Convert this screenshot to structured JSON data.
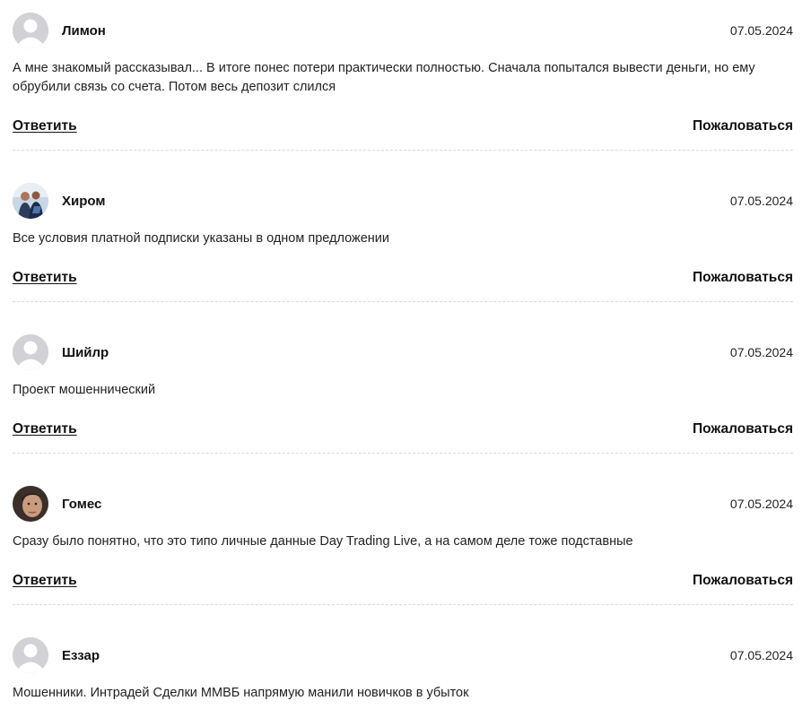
{
  "comments": [
    {
      "author": "Лимон",
      "date": "07.05.2024",
      "text": "А мне знакомый рассказывал... В итоге понес потери практически полностью. Сначала попытался вывести деньги, но ему обрубили связь со счета. Потом весь депозит слился",
      "avatar": "default-avatar-icon",
      "reply_label": "Ответить",
      "report_label": "Пожаловаться"
    },
    {
      "author": "Хиром",
      "date": "07.05.2024",
      "text": "Все условия платной подписки указаны в одном предложении",
      "avatar": "user-photo",
      "reply_label": "Ответить",
      "report_label": "Пожаловаться"
    },
    {
      "author": "Шийлр",
      "date": "07.05.2024",
      "text": "Проект мошеннический",
      "avatar": "default-avatar-icon",
      "reply_label": "Ответить",
      "report_label": "Пожаловаться"
    },
    {
      "author": "Гомес",
      "date": "07.05.2024",
      "text": "Сразу было понятно, что это типо личные данные Day Trading Live, а на самом деле тоже подставные",
      "avatar": "user-photo",
      "reply_label": "Ответить",
      "report_label": "Пожаловаться"
    },
    {
      "author": "Еззар",
      "date": "07.05.2024",
      "text": "Мошенники. Интрадей Сделки ММВБ напрямую манили новичков в убыток",
      "avatar": "default-avatar-icon"
    }
  ],
  "colors": {
    "text": "#1a1a1a",
    "avatar_placeholder": "#d2d2d6",
    "divider": "#d9d9d9"
  }
}
